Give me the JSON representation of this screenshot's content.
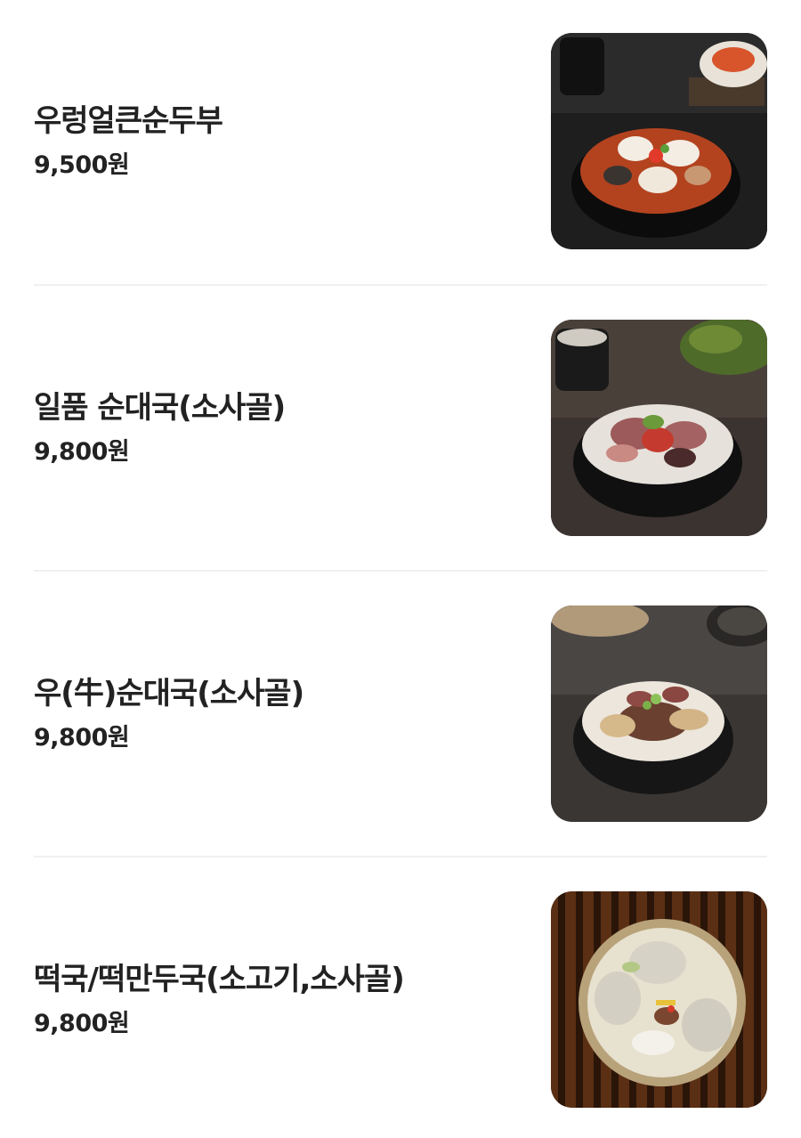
{
  "menu": {
    "items": [
      {
        "name": "우렁얼큰순두부",
        "price": "9,500원",
        "image": "spicy-soft-tofu-stew-photo"
      },
      {
        "name": "일품 순대국(소사골)",
        "price": "9,800원",
        "image": "sundae-gukbap-photo"
      },
      {
        "name": "우(牛)순대국(소사골)",
        "price": "9,800원",
        "image": "beef-sundae-soup-photo"
      },
      {
        "name": "떡국/떡만두국(소고기,소사골)",
        "price": "9,800원",
        "image": "rice-cake-dumpling-soup-photo"
      }
    ]
  }
}
